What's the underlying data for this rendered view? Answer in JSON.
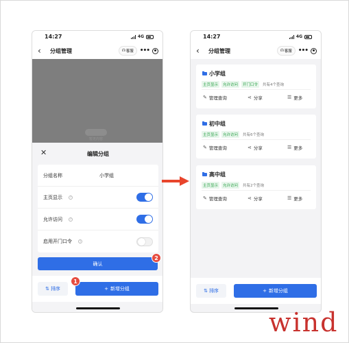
{
  "status": {
    "time": "14:27",
    "network": "4G"
  },
  "nav": {
    "title": "分组管理",
    "service_label": "客服",
    "more": "•••"
  },
  "left": {
    "empty_hint": "暂无内容",
    "sheet": {
      "title": "编辑分组",
      "close": "✕",
      "rows": {
        "name_label": "分组名称",
        "name_value": "小学组",
        "home_label": "主页显示",
        "home_on": true,
        "access_label": "允许访问",
        "access_on": true,
        "code_label": "启用开门口令",
        "code_on": false
      },
      "confirm": "确认"
    },
    "badge_confirm": "2",
    "badge_add": "1"
  },
  "bottom": {
    "sort": "排序",
    "sort_icon": "⇅",
    "add": "新增分组",
    "add_icon": "+"
  },
  "right": {
    "cards": [
      {
        "title": "小学组",
        "tags": [
          "主页显示",
          "允许访问",
          "开门口令"
        ],
        "count": "共有4个查询"
      },
      {
        "title": "初中组",
        "tags": [
          "主页显示",
          "允许访问"
        ],
        "count": "共有6个查询"
      },
      {
        "title": "高中组",
        "tags": [
          "主页显示",
          "允许访问"
        ],
        "count": "共有2个查询"
      }
    ],
    "actions": {
      "manage": "管理查询",
      "share": "分享",
      "more": "更多"
    }
  },
  "icons": {
    "back": "chevron-left-icon",
    "headset": "headset-icon",
    "target": "target-icon",
    "folder": "folder-icon",
    "edit": "edit-icon",
    "share": "share-icon",
    "menu": "menu-icon",
    "arrow": "arrow-right-icon"
  },
  "colors": {
    "primary": "#2f6ee6",
    "badge": "#e64b3f",
    "tag_text": "#2fa34a",
    "tag_bg": "#e8f6ec",
    "arrow": "#e8452c",
    "watermark": "#c8322e"
  },
  "watermark": "wind"
}
